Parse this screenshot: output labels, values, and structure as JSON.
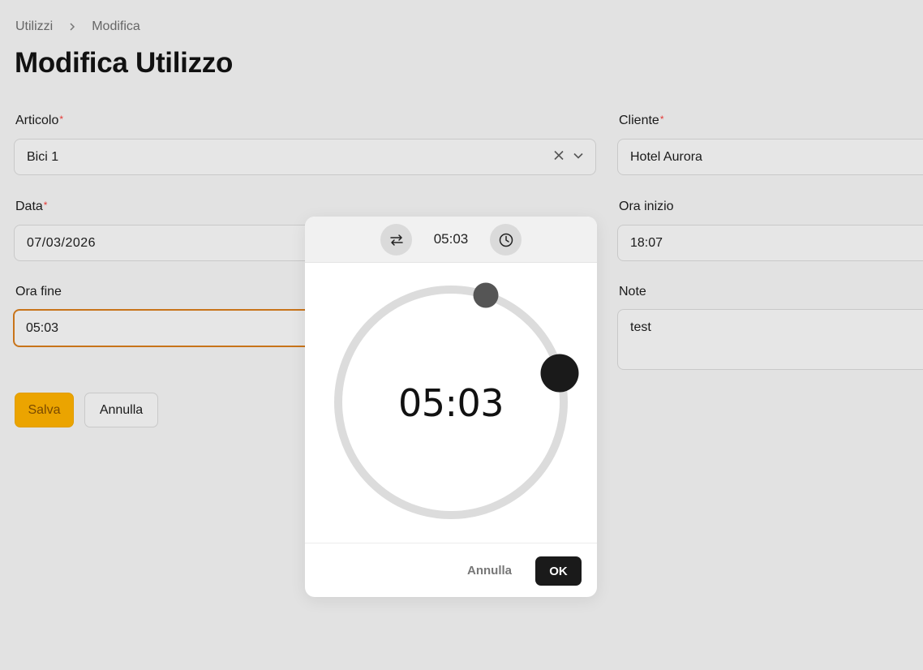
{
  "breadcrumb": {
    "items": [
      "Utilizzi",
      "Modifica"
    ]
  },
  "page": {
    "title": "Modifica Utilizzo"
  },
  "form": {
    "articolo": {
      "label": "Articolo",
      "required_mark": "*",
      "value": "Bici 1"
    },
    "cliente": {
      "label": "Cliente",
      "required_mark": "*",
      "value": "Hotel Aurora"
    },
    "data": {
      "label": "Data",
      "required_mark": "*",
      "value": "07/03/2026"
    },
    "ora_inizio": {
      "label": "Ora inizio",
      "value": "18:07"
    },
    "ora_fine": {
      "label": "Ora fine",
      "value": "05:03"
    },
    "note": {
      "label": "Note",
      "value": "test"
    }
  },
  "actions": {
    "save_label": "Salva",
    "cancel_label": "Annulla"
  },
  "time_picker": {
    "header_time": "05:03",
    "dial_time": "05:03",
    "cancel_label": "Annulla",
    "ok_label": "OK",
    "icons": {
      "swap": "swap-arrows-icon",
      "clock": "clock-icon"
    }
  },
  "colors": {
    "accent": "#eba400",
    "focus_border": "#c8741a",
    "required": "#e53935",
    "ok_button": "#1a1a1a"
  }
}
